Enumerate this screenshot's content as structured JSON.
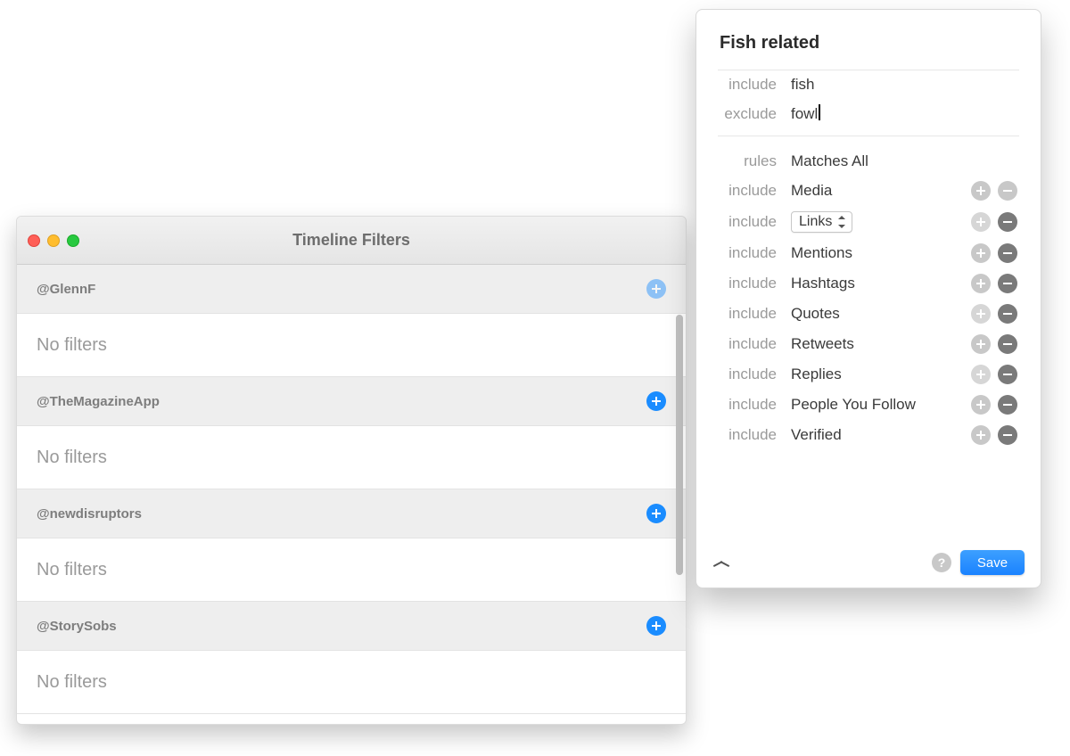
{
  "window": {
    "title": "Timeline Filters"
  },
  "accounts": [
    {
      "handle": "@GlennF",
      "body": "No filters",
      "add_dimmed": true
    },
    {
      "handle": "@TheMagazineApp",
      "body": "No filters",
      "add_dimmed": false
    },
    {
      "handle": "@newdisruptors",
      "body": "No filters",
      "add_dimmed": false
    },
    {
      "handle": "@StorySobs",
      "body": "No filters",
      "add_dimmed": false
    }
  ],
  "popover": {
    "name": "Fish related",
    "keywords": {
      "include_label": "include",
      "include_value": "fish",
      "exclude_label": "exclude",
      "exclude_value": "fowl"
    },
    "rules_header": {
      "label": "rules",
      "value": "Matches All"
    },
    "rules": [
      {
        "mode": "include",
        "type": "Media",
        "plus_dim": false,
        "minus_dim": true,
        "has_select": false
      },
      {
        "mode": "include",
        "type": "Links",
        "plus_dim": true,
        "minus_dim": false,
        "has_select": true
      },
      {
        "mode": "include",
        "type": "Mentions",
        "plus_dim": false,
        "minus_dim": false,
        "has_select": false
      },
      {
        "mode": "include",
        "type": "Hashtags",
        "plus_dim": false,
        "minus_dim": false,
        "has_select": false
      },
      {
        "mode": "include",
        "type": "Quotes",
        "plus_dim": true,
        "minus_dim": false,
        "has_select": false
      },
      {
        "mode": "include",
        "type": "Retweets",
        "plus_dim": false,
        "minus_dim": false,
        "has_select": false
      },
      {
        "mode": "include",
        "type": "Replies",
        "plus_dim": true,
        "minus_dim": false,
        "has_select": false
      },
      {
        "mode": "include",
        "type": "People You Follow",
        "plus_dim": false,
        "minus_dim": false,
        "has_select": false
      },
      {
        "mode": "include",
        "type": "Verified",
        "plus_dim": false,
        "minus_dim": false,
        "has_select": false
      }
    ],
    "save_label": "Save",
    "help_label": "?"
  }
}
